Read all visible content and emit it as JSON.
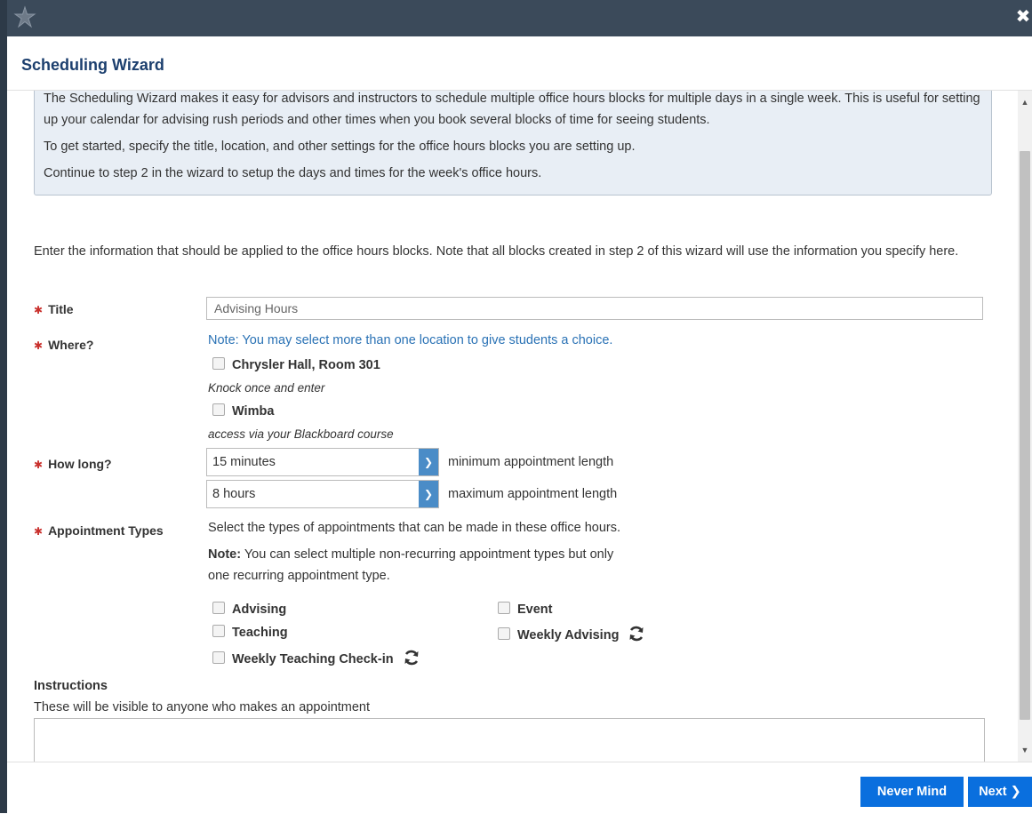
{
  "window": {
    "close_glyph": "✖"
  },
  "dialog": {
    "title": "Scheduling Wizard"
  },
  "intro": {
    "p1": "The Scheduling Wizard makes it easy for advisors and instructors to schedule multiple office hours blocks for multiple days in a single week. This is useful for setting up your calendar for advising rush periods and other times when you book several blocks of time for seeing students.",
    "p2": "To get started, specify the title, location, and other settings for the office hours blocks you are setting up.",
    "p3": "Continue to step 2 in the wizard to setup the days and times for the week's office hours."
  },
  "lead_text": "Enter the information that should be applied to the office hours blocks. Note that all blocks created in step 2 of this wizard will use the information you specify here.",
  "form": {
    "required_mark": "✱",
    "title_label": "Title",
    "title_value": "Advising Hours",
    "where_label": "Where?",
    "where_note": "Note: You may select more than one location to give students a choice.",
    "locations": [
      {
        "name": "Chrysler Hall, Room 301",
        "desc": "Knock once and enter"
      },
      {
        "name": "Wimba",
        "desc": "access via your Blackboard course"
      }
    ],
    "howlong_label": "How long?",
    "min_value": "15 minutes",
    "min_hint": "minimum appointment length",
    "max_value": "8 hours",
    "max_hint": "maximum appointment length",
    "apt_label": "Appointment Types",
    "apt_intro": "Select the types of appointments that can be made in these office hours.",
    "apt_note_bold": "Note:",
    "apt_note_line1": " You can select multiple non-recurring appointment types but only",
    "apt_note_line2": "one recurring appointment type.",
    "apt_types": [
      "Advising",
      "Event",
      "Teaching",
      "Weekly Advising",
      "Weekly Teaching Check-in"
    ],
    "instructions_label": "Instructions",
    "instructions_sub": "These will be visible to anyone who makes an appointment"
  },
  "buttons": {
    "never_mind": "Never Mind",
    "next": "Next ❯"
  },
  "icons": {
    "logo": "star-logo-icon",
    "close": "close-icon",
    "recurring": "recurring-icon",
    "select_arrow": "chevron-down-icon"
  },
  "colors": {
    "topbar": "#3b4a5a",
    "title": "#1c3f6e",
    "link_note": "#2a72b5",
    "button": "#0a6fde",
    "required": "#c9302c",
    "intro_bg": "#e8eef5"
  }
}
